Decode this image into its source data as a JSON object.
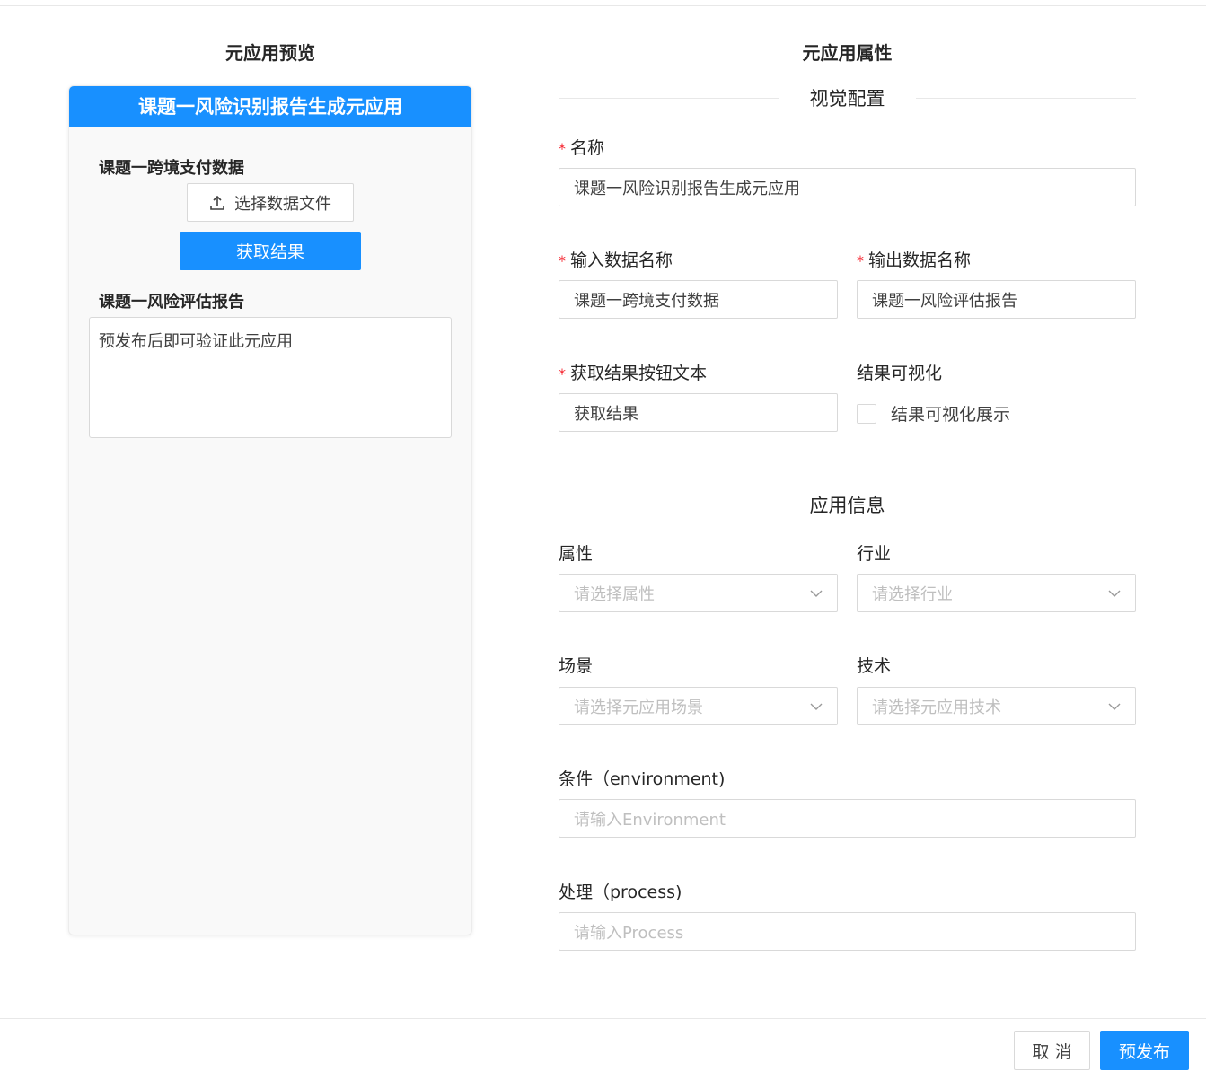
{
  "preview": {
    "title": "元应用预览",
    "header": "课题一风险识别报告生成元应用",
    "input_label": "课题一跨境支付数据",
    "upload_label": "选择数据文件",
    "fetch_label": "获取结果",
    "output_label": "课题一风险评估报告",
    "output_text": "预发布后即可验证此元应用"
  },
  "properties": {
    "title": "元应用属性",
    "visual_section": "视觉配置",
    "name": {
      "label": "名称",
      "value": "课题一风险识别报告生成元应用"
    },
    "input_name": {
      "label": "输入数据名称",
      "value": "课题一跨境支付数据"
    },
    "output_name": {
      "label": "输出数据名称",
      "value": "课题一风险评估报告"
    },
    "button_text": {
      "label": "获取结果按钮文本",
      "value": "获取结果"
    },
    "visualize": {
      "label": "结果可视化",
      "checkbox_label": "结果可视化展示",
      "checked": false
    },
    "info_section": "应用信息",
    "attribute": {
      "label": "属性",
      "placeholder": "请选择属性"
    },
    "industry": {
      "label": "行业",
      "placeholder": "请选择行业"
    },
    "scene": {
      "label": "场景",
      "placeholder": "请选择元应用场景"
    },
    "technology": {
      "label": "技术",
      "placeholder": "请选择元应用技术"
    },
    "environment": {
      "label": "条件（environment)",
      "placeholder": "请输入Environment"
    },
    "process": {
      "label": "处理（process)",
      "placeholder": "请输入Process"
    }
  },
  "footer": {
    "cancel_label": "取 消",
    "publish_label": "预发布"
  },
  "icons": {
    "upload": "upload-icon",
    "chevron": "chevron-down-icon"
  },
  "colors": {
    "primary": "#1890ff",
    "required": "#f5222d",
    "border": "#d9d9d9"
  }
}
